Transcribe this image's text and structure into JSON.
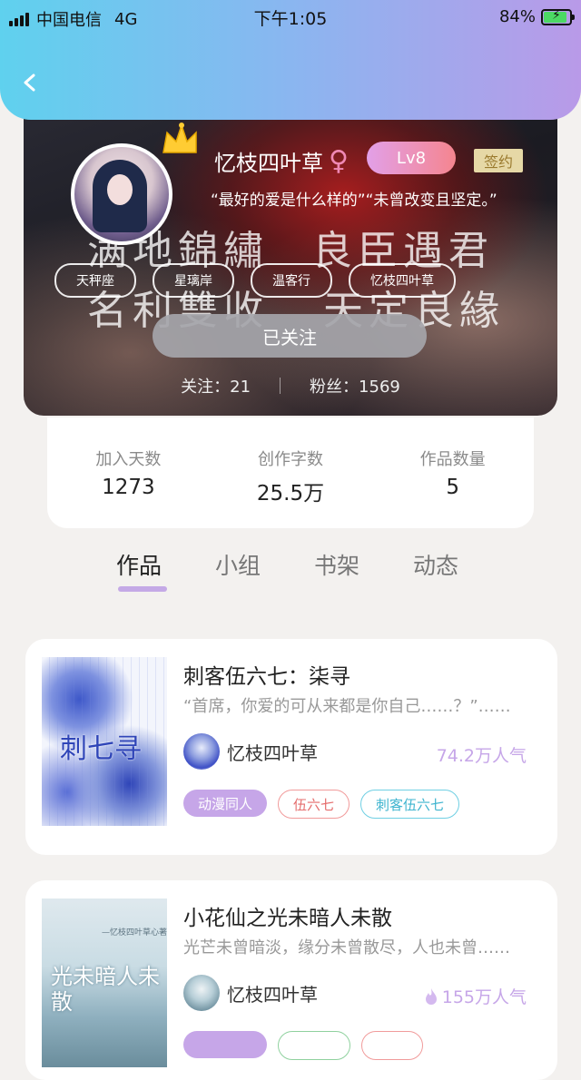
{
  "status_bar": {
    "carrier": "中国电信",
    "network": "4G",
    "time": "下午1:05",
    "battery": "84%",
    "battery_level": 0.84
  },
  "header": {
    "back_icon": "chevron-left-icon",
    "gradient": [
      "#5fd1ee",
      "#b99ae8"
    ]
  },
  "profile": {
    "username": "忆枝四叶草",
    "gender_icon": "female-icon",
    "level": "Lv8",
    "sign_badge": "签约",
    "motto": "“最好的爱是什么样的”“未曾改变且坚定。”",
    "banner_calligraphy": [
      "满地錦繡",
      "良臣遇君",
      "名利雙收",
      "天定良緣"
    ],
    "tags": [
      "天秤座",
      "星璃岸",
      "温客行",
      "忆枝四叶草"
    ],
    "follow_button": "已关注",
    "following_label": "关注：",
    "following": "21",
    "fans_label": "粉丝：",
    "fans": "1569"
  },
  "stats": [
    {
      "label": "加入天数",
      "value": "1273"
    },
    {
      "label": "创作字数",
      "value": "25.5万"
    },
    {
      "label": "作品数量",
      "value": "5"
    }
  ],
  "tabs": [
    "作品",
    "小组",
    "书架",
    "动态"
  ],
  "active_tab": "作品",
  "accent_color": "#c6a6e8",
  "books": [
    {
      "title": "刺客伍六七：柒寻",
      "desc": "“首席，你爱的可从来都是你自己……？”……",
      "author": "忆枝四叶草",
      "popularity": "74.2万人气",
      "tags": [
        "动漫同人",
        "伍六七",
        "刺客伍六七"
      ],
      "cover_text": "刺七寻"
    },
    {
      "title": "小花仙之光未暗人未散",
      "desc": "光芒未曾暗淡，缘分未曾散尽，人也未曾……",
      "author": "忆枝四叶草",
      "popularity": "155万人气",
      "tags": [
        "",
        "",
        ""
      ],
      "cover_text": "光未暗人未散",
      "cover_small": "—忆枝四叶草心著"
    }
  ]
}
